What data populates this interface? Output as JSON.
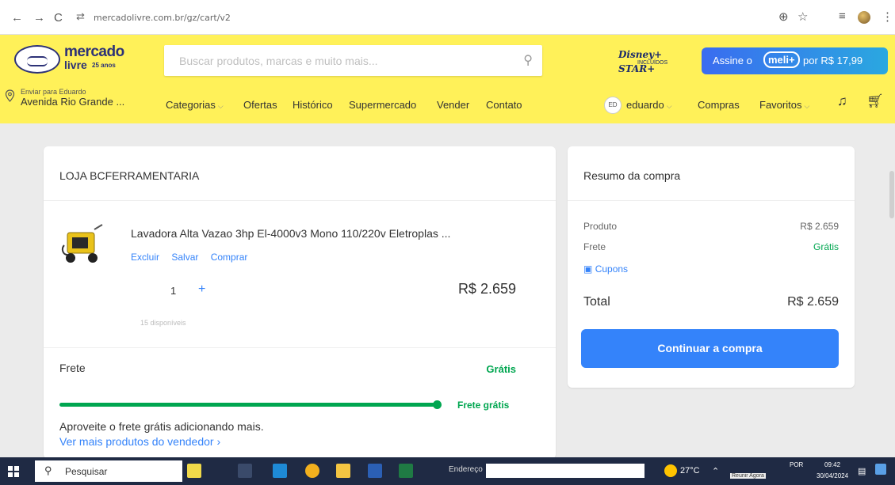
{
  "browser": {
    "url": "mercadolivre.com.br/gz/cart/v2"
  },
  "header": {
    "logo_line1": "mercado",
    "logo_line2": "livre",
    "logo_badge": "25 anos",
    "search_placeholder": "Buscar produtos, marcas e muito mais...",
    "disney_line1": "Disney+ STAR+",
    "disney_line2": "INCLUÍDOS",
    "meli_prefix": "Assine o",
    "meli_brand": "meli+",
    "meli_suffix": "por R$ 17,99",
    "location_line1": "Enviar para Eduardo",
    "location_line2": "Avenida Rio Grande ...",
    "nav": [
      "Categorias",
      "Ofertas",
      "Histórico",
      "Supermercado",
      "Vender",
      "Contato"
    ],
    "user_initials": "ED",
    "user_name": "eduardo",
    "compras": "Compras",
    "favoritos": "Favoritos"
  },
  "cart": {
    "store_name": "LOJA BCFERRAMENTARIA",
    "product_title": "Lavadora Alta Vazao 3hp El-4000v3 Mono 110/220v Eletroplas ...",
    "actions": [
      "Excluir",
      "Salvar",
      "Comprar"
    ],
    "quantity": "1",
    "available": "15 disponíveis",
    "price": "R$ 2.659",
    "frete_label": "Frete",
    "frete_value": "Grátis",
    "free_shipping_label": "Frete grátis",
    "free_shipping_progress": 1.0,
    "promo_text": "Aproveite o frete grátis adicionando mais.",
    "more_link": "Ver mais produtos do vendedor ›"
  },
  "summary": {
    "title": "Resumo da compra",
    "produto_label": "Produto",
    "produto_value": "R$ 2.659",
    "frete_label": "Frete",
    "frete_value": "Grátis",
    "cupons": "Cupons",
    "total_label": "Total",
    "total_value": "R$ 2.659",
    "cta": "Continuar a compra"
  },
  "taskbar": {
    "search": "Pesquisar",
    "address_label": "Endereço",
    "temperature": "27°C",
    "language": "POR",
    "time": "09:42",
    "date": "30/04/2024",
    "tooltip": "Reunir Agora"
  },
  "colors": {
    "header_bg": "#fff159",
    "accent_blue": "#3483fa",
    "green": "#00a650"
  }
}
